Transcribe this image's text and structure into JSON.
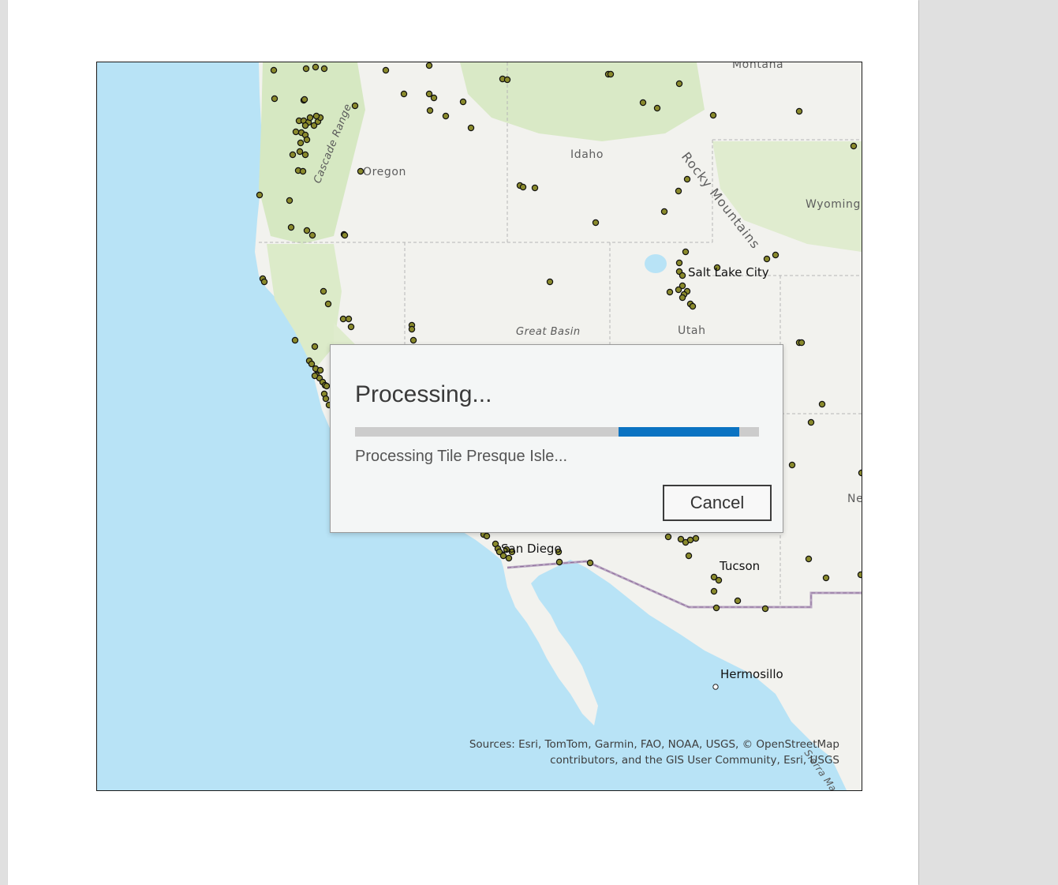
{
  "map": {
    "labels": {
      "montana": "Montana",
      "idaho": "Idaho",
      "oregon": "Oregon",
      "wyoming": "Wyoming",
      "utah": "Utah",
      "salt_lake_city": "Salt Lake City",
      "great_basin": "Great Basin",
      "cascade_range": "Cascade Range",
      "rocky_mountains": "Rocky Mountains",
      "san_diego": "San Diego",
      "tucson": "Tucson",
      "hermosillo": "Hermosillo",
      "ne_partial": "Ne",
      "sierra_madre_partial": "Sierra Mad"
    },
    "attribution": {
      "line1": "Sources: Esri, TomTom, Garmin, FAO, NOAA, USGS, © OpenStreetMap",
      "line2": "contributors, and the GIS User Community, Esri, USGS"
    },
    "colors": {
      "ocean": "#b8e3f6",
      "land": "#f2f2ee",
      "forest": "#d6e8c2",
      "point_fill": "#8a8a2c"
    }
  },
  "dialog": {
    "title": "Processing...",
    "status": "Processing Tile Presque Isle...",
    "cancel_label": "Cancel",
    "progress": {
      "start_fraction": 0.652,
      "end_fraction": 0.951
    },
    "colors": {
      "track": "#cccccc",
      "fill": "#0a73c2"
    }
  }
}
